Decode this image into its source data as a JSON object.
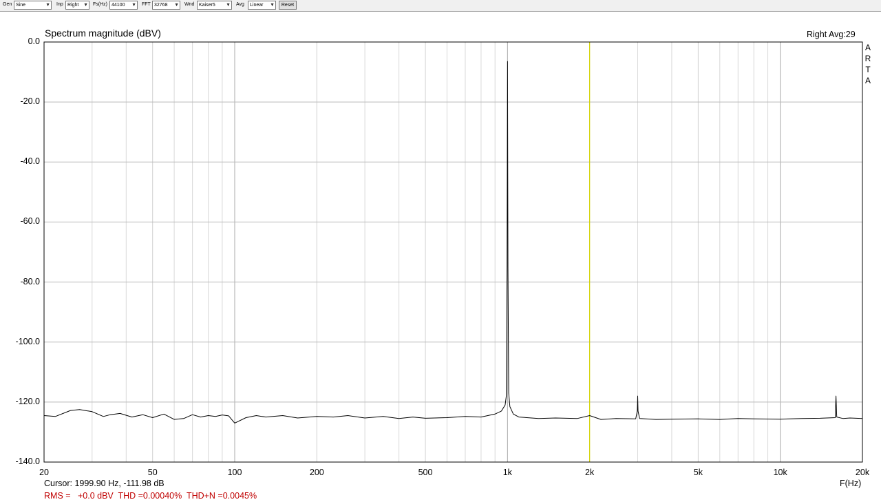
{
  "toolbar": {
    "gen_label": "Gen",
    "gen_value": "Sine",
    "inp_label": "Inp",
    "inp_value": "Right",
    "fs_label": "Fs(Hz)",
    "fs_value": "44100",
    "fft_label": "FFT",
    "fft_value": "32768",
    "wnd_label": "Wnd",
    "wnd_value": "Kaiser5",
    "avg_label": "Avg",
    "avg_value": "Linear",
    "reset_label": "Reset"
  },
  "header": {
    "title": "Spectrum magnitude (dBV)",
    "channel_status": "Right  Avg:29",
    "logo_letters": [
      "A",
      "R",
      "T",
      "A"
    ]
  },
  "footer": {
    "cursor_readout": "Cursor: 1999.90 Hz, -111.98 dB",
    "measurement": "RMS =   +0.0 dBV  THD =0.00040%  THD+N =0.0045%"
  },
  "chart_data": {
    "type": "line",
    "title": "Spectrum magnitude (dBV)",
    "xlabel": "F(Hz)",
    "ylabel": "",
    "x_scale": "log",
    "xlim": [
      20,
      20000
    ],
    "ylim": [
      -140,
      0
    ],
    "x_ticks": [
      {
        "value": 20,
        "label": "20"
      },
      {
        "value": 50,
        "label": "50"
      },
      {
        "value": 100,
        "label": "100"
      },
      {
        "value": 200,
        "label": "200"
      },
      {
        "value": 500,
        "label": "500"
      },
      {
        "value": 1000,
        "label": "1k"
      },
      {
        "value": 2000,
        "label": "2k"
      },
      {
        "value": 5000,
        "label": "5k"
      },
      {
        "value": 10000,
        "label": "10k"
      },
      {
        "value": 20000,
        "label": "20k"
      }
    ],
    "y_ticks": [
      {
        "value": 0,
        "label": "0.0"
      },
      {
        "value": -20,
        "label": "-20.0"
      },
      {
        "value": -40,
        "label": "-40.0"
      },
      {
        "value": -60,
        "label": "-60.0"
      },
      {
        "value": -80,
        "label": "-80.0"
      },
      {
        "value": -100,
        "label": "-100.0"
      },
      {
        "value": -120,
        "label": "-120.0"
      },
      {
        "value": -140,
        "label": "-140.0"
      }
    ],
    "grid": true,
    "cursor": {
      "x": 1999.9,
      "y": -111.98,
      "color": "#d4d400"
    },
    "series": [
      {
        "color": "#000000",
        "points": [
          [
            20,
            -124.5
          ],
          [
            22,
            -124.8
          ],
          [
            25,
            -122.8
          ],
          [
            27,
            -122.5
          ],
          [
            30,
            -123.2
          ],
          [
            33,
            -124.8
          ],
          [
            35,
            -124.2
          ],
          [
            38,
            -123.8
          ],
          [
            42,
            -125.0
          ],
          [
            46,
            -124.2
          ],
          [
            50,
            -125.2
          ],
          [
            55,
            -124.0
          ],
          [
            60,
            -125.8
          ],
          [
            65,
            -125.5
          ],
          [
            70,
            -124.2
          ],
          [
            75,
            -125.0
          ],
          [
            80,
            -124.5
          ],
          [
            85,
            -124.8
          ],
          [
            90,
            -124.3
          ],
          [
            95,
            -124.6
          ],
          [
            100,
            -127.0
          ],
          [
            110,
            -125.2
          ],
          [
            120,
            -124.5
          ],
          [
            130,
            -125.0
          ],
          [
            150,
            -124.5
          ],
          [
            170,
            -125.3
          ],
          [
            200,
            -124.8
          ],
          [
            230,
            -125.0
          ],
          [
            260,
            -124.5
          ],
          [
            300,
            -125.3
          ],
          [
            350,
            -124.8
          ],
          [
            400,
            -125.5
          ],
          [
            450,
            -125.0
          ],
          [
            500,
            -125.4
          ],
          [
            600,
            -125.2
          ],
          [
            700,
            -124.8
          ],
          [
            800,
            -125.0
          ],
          [
            900,
            -124.0
          ],
          [
            950,
            -123.0
          ],
          [
            980,
            -121.0
          ],
          [
            990,
            -118.0
          ],
          [
            996,
            -75.0
          ],
          [
            1000,
            -6.5
          ],
          [
            1004,
            -75.0
          ],
          [
            1010,
            -117.0
          ],
          [
            1020,
            -121.5
          ],
          [
            1050,
            -124.0
          ],
          [
            1100,
            -125.0
          ],
          [
            1300,
            -125.5
          ],
          [
            1500,
            -125.3
          ],
          [
            1800,
            -125.5
          ],
          [
            2000,
            -124.5
          ],
          [
            2200,
            -125.8
          ],
          [
            2500,
            -125.5
          ],
          [
            2950,
            -125.6
          ],
          [
            2990,
            -123.0
          ],
          [
            3000,
            -118.0
          ],
          [
            3010,
            -123.0
          ],
          [
            3050,
            -125.5
          ],
          [
            3500,
            -125.8
          ],
          [
            4000,
            -125.7
          ],
          [
            5000,
            -125.6
          ],
          [
            6000,
            -125.8
          ],
          [
            7000,
            -125.5
          ],
          [
            8000,
            -125.6
          ],
          [
            10000,
            -125.7
          ],
          [
            12000,
            -125.5
          ],
          [
            14000,
            -125.4
          ],
          [
            15900,
            -125.2
          ],
          [
            16000,
            -118.0
          ],
          [
            16100,
            -125.0
          ],
          [
            17000,
            -125.5
          ],
          [
            18000,
            -125.3
          ],
          [
            20000,
            -125.5
          ]
        ]
      }
    ]
  }
}
